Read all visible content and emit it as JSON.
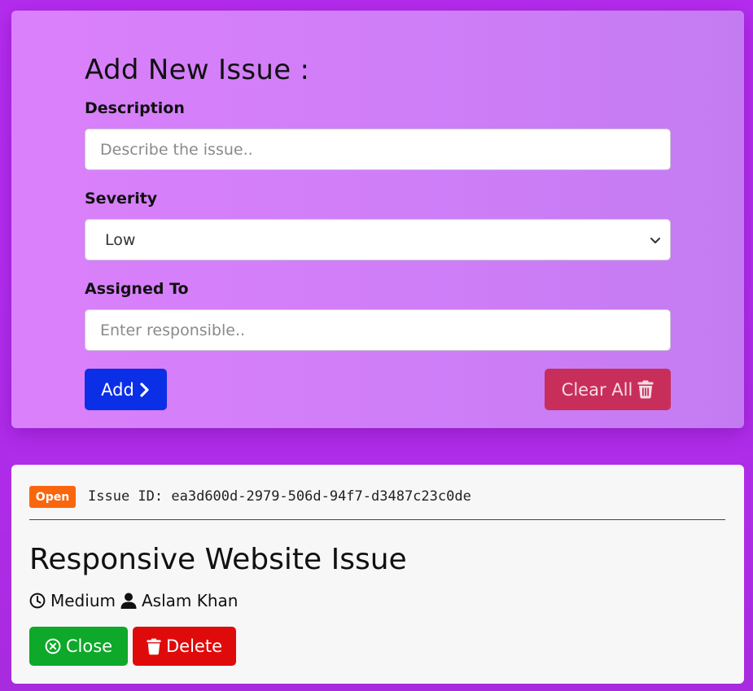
{
  "form": {
    "title": "Add New Issue :",
    "description": {
      "label": "Description",
      "placeholder": "Describe the issue..",
      "value": ""
    },
    "severity": {
      "label": "Severity",
      "selected": "Low"
    },
    "assigned_to": {
      "label": "Assigned To",
      "placeholder": "Enter responsible..",
      "value": ""
    },
    "add_label": "Add",
    "clear_all_label": "Clear All"
  },
  "issues": [
    {
      "status": "Open",
      "id_label": "Issue ID:",
      "id": "ea3d600d-2979-506d-94f7-d3487c23c0de",
      "title": "Responsive Website Issue",
      "severity": "Medium",
      "assignee": "Aslam Khan",
      "close_label": "Close",
      "delete_label": "Delete"
    }
  ],
  "colors": {
    "add_button": "#0b2fe6",
    "clear_button": "#c72f5a",
    "open_badge": "#f9660d",
    "close_button": "#0ea82a",
    "delete_button": "#df0b0b"
  },
  "icons": {
    "add": "chevron-right-icon",
    "clear_all": "trash-icon",
    "severity": "clock-icon",
    "assignee": "user-icon",
    "close": "times-circle-icon",
    "delete": "trash-icon",
    "select": "chevron-down-icon"
  }
}
